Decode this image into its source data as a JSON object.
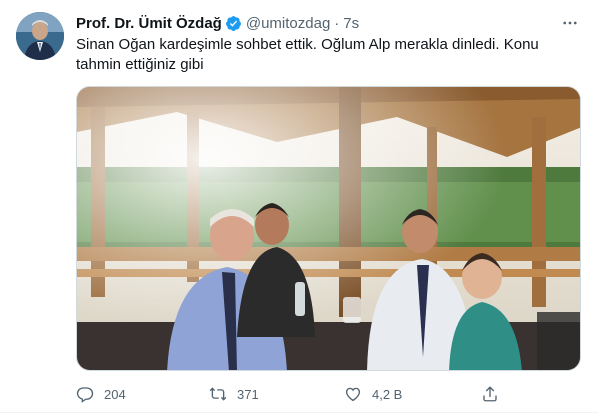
{
  "tweet": {
    "author_name": "Prof. Dr. Ümit Özdağ",
    "handle": "@umitozdag",
    "separator": "·",
    "time": "7s",
    "text": "Sinan Oğan kardeşimle sohbet ettik. Oğlum Alp merakla dinledi. Konu tahmin ettiğiniz gibi"
  },
  "actions": {
    "reply_count": "204",
    "retweet_count": "371",
    "like_count": "4,2 B"
  },
  "icons": {
    "verified": "verified-badge-icon",
    "more": "more-options-icon",
    "reply": "reply-icon",
    "retweet": "retweet-icon",
    "like": "heart-icon",
    "share": "share-icon"
  },
  "colors": {
    "verified": "#1d9bf0",
    "secondary_text": "#536471",
    "primary_text": "#0f1419"
  }
}
